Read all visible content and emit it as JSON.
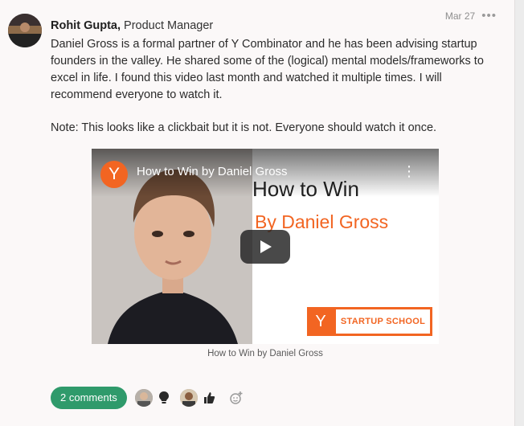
{
  "post": {
    "author": "Rohit Gupta,",
    "role": "Product Manager",
    "date": "Mar 27",
    "more": "•••",
    "paragraphs": [
      "Daniel Gross is a formal partner of Y Combinator and he has been advising startup founders in the valley. He shared some of the (logical) mental models/frameworks to excel in life. I found this video last month and watched it multiple times. I will recommend everyone to watch it.",
      "Note: This looks like a clickbait but it is not. Everyone should watch it once."
    ]
  },
  "video": {
    "channel_logo": "Y",
    "title": "How to Win by Daniel Gross",
    "menu": "⋮",
    "headline": "How to Win",
    "subheadline": "By Daniel Gross",
    "badge_logo": "Y",
    "badge_text": "STARTUP SCHOOL",
    "caption": "How to Win by Daniel Gross"
  },
  "footer": {
    "comments_label": "2 comments",
    "reactions": [
      {
        "icon": "lightbulb-icon"
      },
      {
        "icon": "thumbs-up-icon"
      },
      {
        "icon": "add-reaction-icon"
      }
    ]
  },
  "colors": {
    "accent": "#2f9a6b",
    "yc_orange": "#f26522"
  }
}
